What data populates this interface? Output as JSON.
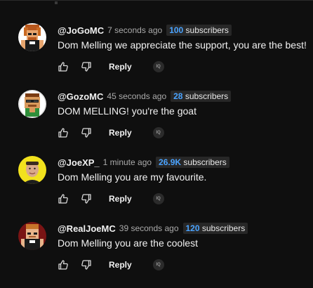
{
  "comments": [
    {
      "handle": "@JoGoMC",
      "time": "7 seconds ago",
      "subs_num": "100",
      "subs_label": " subscribers",
      "text": "Dom Melling we appreciate the support, you are the best!",
      "reply": "Reply",
      "iq": "IQ",
      "avatar_icon": "minecraft-skin-avatar"
    },
    {
      "handle": "@GozoMC",
      "time": "45 seconds ago",
      "subs_num": "28",
      "subs_label": " subscribers",
      "text": "DOM MELLING! you're the goat",
      "reply": "Reply",
      "iq": "IQ",
      "avatar_icon": "minecraft-skin-avatar"
    },
    {
      "handle": "@JoeXP_",
      "time": "1 minute ago",
      "subs_num": "26.9K",
      "subs_label": " subscribers",
      "text": "Dom Melling you are my favourite.",
      "reply": "Reply",
      "iq": "IQ",
      "avatar_icon": "person-avatar"
    },
    {
      "handle": "@RealJoeMC",
      "time": "39 seconds ago",
      "subs_num": "120",
      "subs_label": " subscribers",
      "text": "Dom Melling you are the coolest",
      "reply": "Reply",
      "iq": "IQ",
      "avatar_icon": "minecraft-skin-avatar"
    }
  ],
  "colors": {
    "background": "#0f0f0f",
    "subscriber_number": "#4aa3ff",
    "badge_background": "#272727"
  }
}
